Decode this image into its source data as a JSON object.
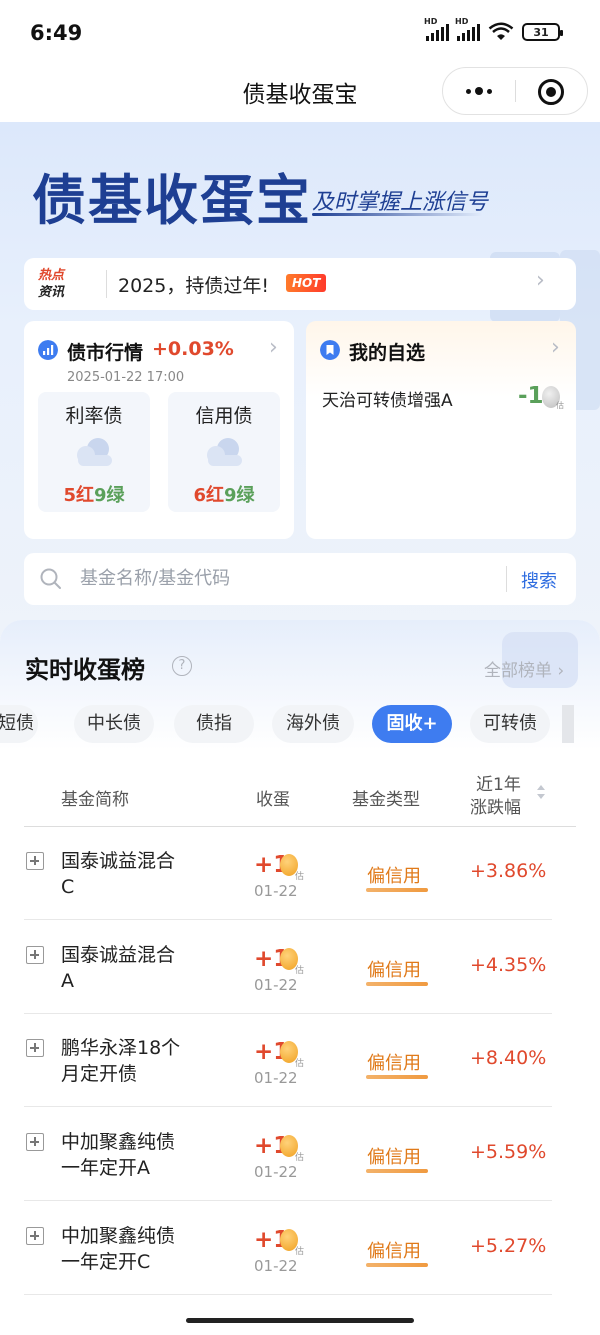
{
  "status": {
    "time": "6:49",
    "battery": "31",
    "sim1": "HD",
    "sim2": "HD"
  },
  "nav": {
    "title": "债基收蛋宝"
  },
  "banner": {
    "logo": "债基收蛋宝",
    "slogan": "及时掌握上涨信号"
  },
  "hot": {
    "tag_line1": "热点",
    "tag_line2": "资讯",
    "text": "2025，持债过年!",
    "badge": "HOT"
  },
  "market": {
    "title": "债市行情",
    "change": "+0.03%",
    "date": "2025-01-22 17:00",
    "items": [
      {
        "label": "利率债",
        "red": "5红",
        "green": "9绿"
      },
      {
        "label": "信用债",
        "red": "6红",
        "green": "9绿"
      }
    ]
  },
  "favorites": {
    "title": "我的自选",
    "item": "天治可转债增强A",
    "value": "-1",
    "egg_note": "估"
  },
  "search": {
    "placeholder": "基金名称/基金代码",
    "button": "搜索"
  },
  "ranking": {
    "title": "实时收蛋榜",
    "help": "?",
    "all_label": "全部榜单",
    "tabs": [
      "短债",
      "中长债",
      "债指",
      "海外债",
      "固收+",
      "可转债"
    ],
    "active_tab": "固收+",
    "headers": {
      "name": "基金简称",
      "egg": "收蛋",
      "type": "基金类型",
      "change_l1": "近1年",
      "change_l2": "涨跌幅"
    },
    "rows": [
      {
        "name_l1": "国泰诚益混合",
        "name_l2": "C",
        "egg": "+1",
        "egg_note": "估",
        "date": "01-22",
        "type": "偏信用",
        "change": "+3.86%"
      },
      {
        "name_l1": "国泰诚益混合",
        "name_l2": "A",
        "egg": "+1",
        "egg_note": "估",
        "date": "01-22",
        "type": "偏信用",
        "change": "+4.35%"
      },
      {
        "name_l1": "鹏华永泽18个",
        "name_l2": "月定开债",
        "egg": "+1",
        "egg_note": "估",
        "date": "01-22",
        "type": "偏信用",
        "change": "+8.40%"
      },
      {
        "name_l1": "中加聚鑫纯债",
        "name_l2": "一年定开A",
        "egg": "+1",
        "egg_note": "估",
        "date": "01-22",
        "type": "偏信用",
        "change": "+5.59%"
      },
      {
        "name_l1": "中加聚鑫纯债",
        "name_l2": "一年定开C",
        "egg": "+1",
        "egg_note": "估",
        "date": "01-22",
        "type": "偏信用",
        "change": "+5.27%"
      }
    ]
  },
  "colors": {
    "accent": "#3e7cf0",
    "up": "#e0492d",
    "down": "#5aa05a",
    "brand": "#1e3f93"
  }
}
